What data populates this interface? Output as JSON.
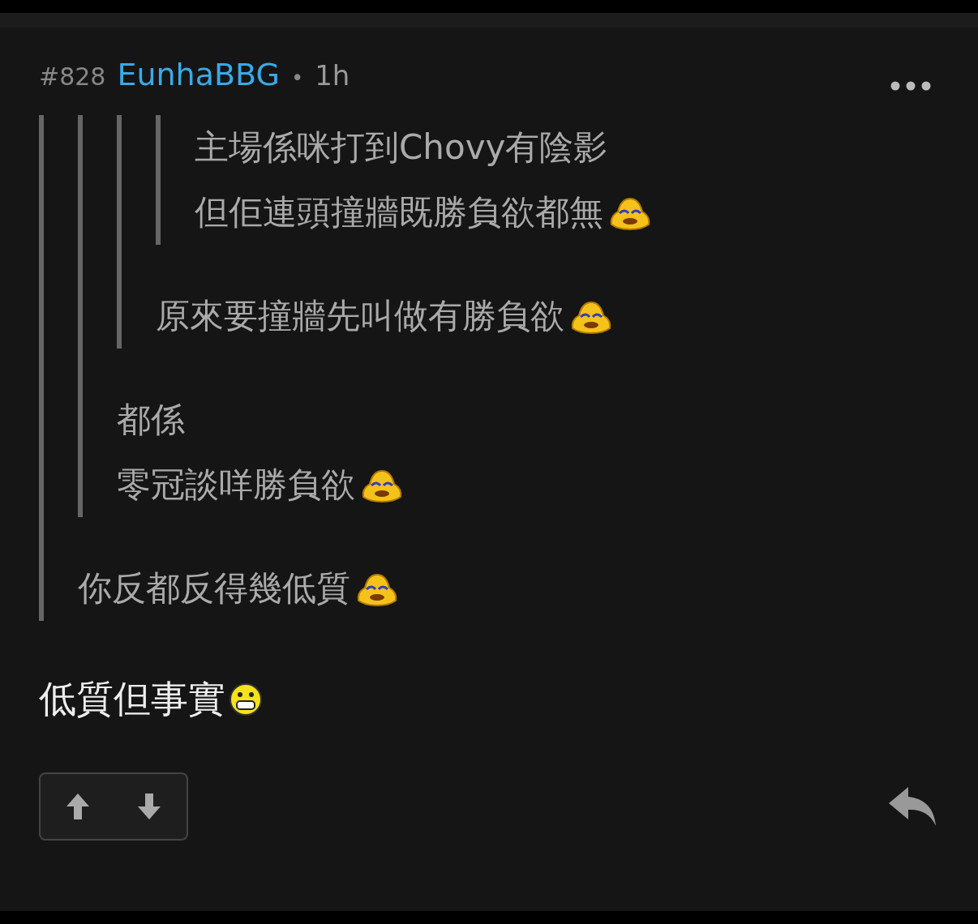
{
  "post": {
    "number": "#828",
    "username": "EunhaBBG",
    "separator": "•",
    "time": "1h"
  },
  "quote": {
    "quote": {
      "quote": {
        "quote": {
          "lines": [
            {
              "text": "主場係咪打到Chovy有陰影"
            },
            {
              "text": "但佢連頭撞牆既勝負欲都無",
              "emoji": {
                "kind": "cry"
              }
            }
          ]
        },
        "lines": [
          {
            "text": "原來要撞牆先叫做有勝負欲",
            "emoji": {
              "kind": "cry"
            }
          }
        ]
      },
      "lines": [
        {
          "text": "都係"
        },
        {
          "text": "零冠談咩勝負欲",
          "emoji": {
            "kind": "cry"
          }
        }
      ]
    },
    "lines": [
      {
        "text": "你反都反得幾低質",
        "emoji": {
          "kind": "cry"
        }
      }
    ]
  },
  "body": [
    {
      "text": "低質但事實",
      "emoji": {
        "kind": "grin"
      }
    }
  ]
}
